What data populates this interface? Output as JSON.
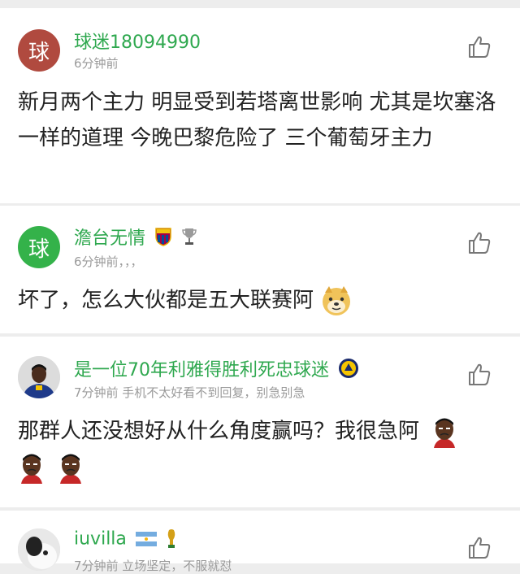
{
  "comments": [
    {
      "avatar_char": "球",
      "avatar_color": "#b04a3f",
      "username": "球迷18094990",
      "meta": "6分钟前",
      "content": "新月两个主力 明显受到若塔离世影响 尤其是坎塞洛 一样的道理 今晚巴黎危险了 三个葡萄牙主力"
    },
    {
      "avatar_char": "球",
      "avatar_color": "#34b24a",
      "username": "澹台无情",
      "meta": "6分钟前，，，",
      "content": "坏了，怎么大伙都是五大联赛阿",
      "badges": [
        "barcelona-badge-icon",
        "trophy-icon"
      ],
      "emoji": "doge-emoji-icon"
    },
    {
      "avatar_char": "",
      "username": "是一位70年利雅得胜利死忠球迷",
      "meta": "7分钟前  手机不太好看不到回复，别急别急",
      "content": "那群人还没想好从什么角度赢吗？我很急阿",
      "badges": [
        "al-nassr-badge-icon"
      ],
      "emoji": "player-face-emoji-icon"
    },
    {
      "avatar_char": "",
      "username": "iuvilla",
      "meta": "7分钟前  立场坚定，不服就怼",
      "badges": [
        "argentina-flag-icon",
        "world-cup-trophy-icon"
      ]
    }
  ],
  "colors": {
    "username": "#2fa84f",
    "meta": "#9a9a9a",
    "text": "#222222",
    "background": "#ededed"
  }
}
